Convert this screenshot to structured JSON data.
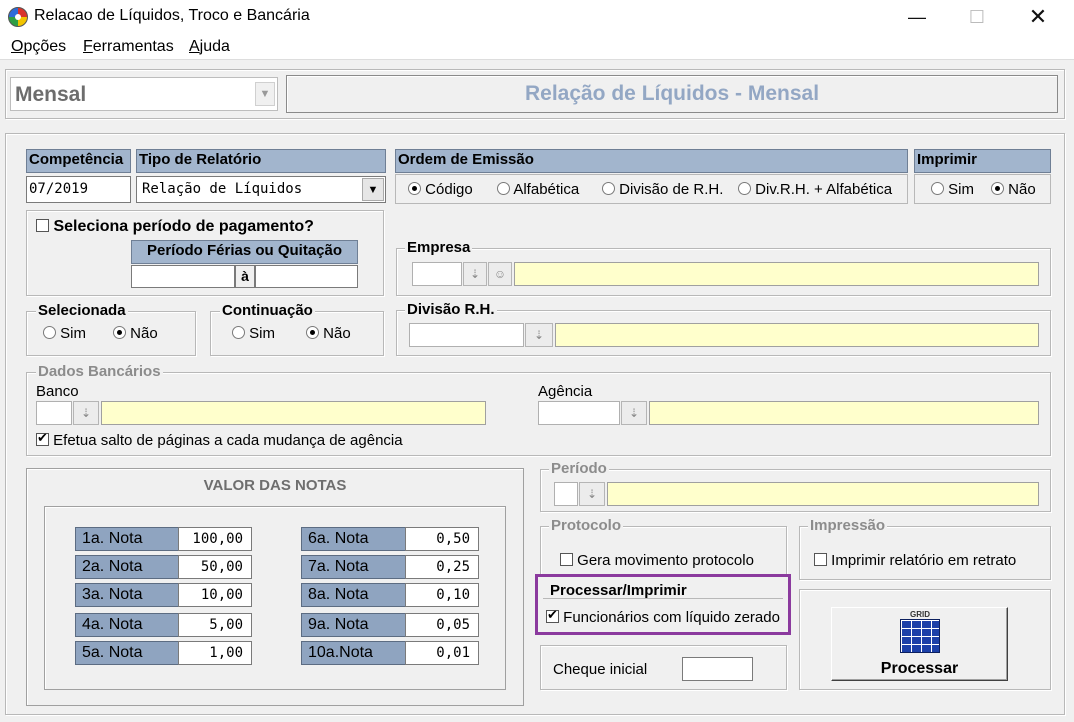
{
  "window": {
    "title": "Relacao de Líquidos, Troco e Bancária"
  },
  "menu": [
    {
      "label_u": "O",
      "label_rest": "pções"
    },
    {
      "label_u": "F",
      "label_rest": "erramentas"
    },
    {
      "label_u": "A",
      "label_rest": "juda"
    }
  ],
  "header": {
    "mode_value": "Mensal",
    "banner": "Relação de Líquidos - Mensal"
  },
  "competencia": {
    "header": "Competência",
    "value": "07/2019"
  },
  "tipo_relatorio": {
    "header": "Tipo de Relatório",
    "value": "Relação de Líquidos"
  },
  "ordem_emissao": {
    "header": "Ordem de Emissão",
    "options": [
      "Código",
      "Alfabética",
      "Divisão de R.H.",
      "Div.R.H. + Alfabética"
    ],
    "selected": 0
  },
  "imprimir": {
    "header": "Imprimir",
    "options": [
      "Sim",
      "Não"
    ],
    "selected": 1
  },
  "periodo_pagamento": {
    "label": "Seleciona período de pagamento?",
    "checked": false,
    "sub_header": "Período Férias ou Quitação",
    "separator": "à"
  },
  "empresa": {
    "legend": "Empresa"
  },
  "selecionada": {
    "legend": "Selecionada",
    "options": [
      "Sim",
      "Não"
    ],
    "selected": 1
  },
  "continuacao": {
    "legend": "Continuação",
    "options": [
      "Sim",
      "Não"
    ],
    "selected": 1
  },
  "divisao_rh": {
    "legend": "Divisão R.H."
  },
  "dados_bancarios": {
    "legend": "Dados Bancários",
    "banco_label": "Banco",
    "agencia_label": "Agência",
    "salto_label": "Efetua salto de páginas a cada mudança de agência",
    "salto_checked": true
  },
  "valor_notas": {
    "title": "VALOR DAS NOTAS",
    "left": [
      {
        "label": "1a. Nota",
        "value": "100,00"
      },
      {
        "label": "2a. Nota",
        "value": "50,00"
      },
      {
        "label": "3a. Nota",
        "value": "10,00"
      },
      {
        "label": "4a. Nota",
        "value": "5,00"
      },
      {
        "label": "5a. Nota",
        "value": "1,00"
      }
    ],
    "right": [
      {
        "label": "6a. Nota",
        "value": "0,50"
      },
      {
        "label": "7a. Nota",
        "value": "0,25"
      },
      {
        "label": "8a. Nota",
        "value": "0,10"
      },
      {
        "label": "9a. Nota",
        "value": "0,05"
      },
      {
        "label": "10a.Nota",
        "value": "0,01"
      }
    ]
  },
  "periodo": {
    "legend": "Período"
  },
  "protocolo": {
    "legend": "Protocolo",
    "label": "Gera movimento protocolo",
    "checked": false
  },
  "impressao": {
    "legend": "Impressão",
    "label": "Imprimir relatório em retrato",
    "checked": false
  },
  "processar_imprimir": {
    "legend": "Processar/Imprimir",
    "label": "Funcionários com líquido zerado",
    "checked": true,
    "highlight_color": "#8b3a9e"
  },
  "cheque": {
    "label": "Cheque inicial",
    "value": ""
  },
  "processar_button": {
    "label": "Processar",
    "icon_caption": "GRID"
  }
}
